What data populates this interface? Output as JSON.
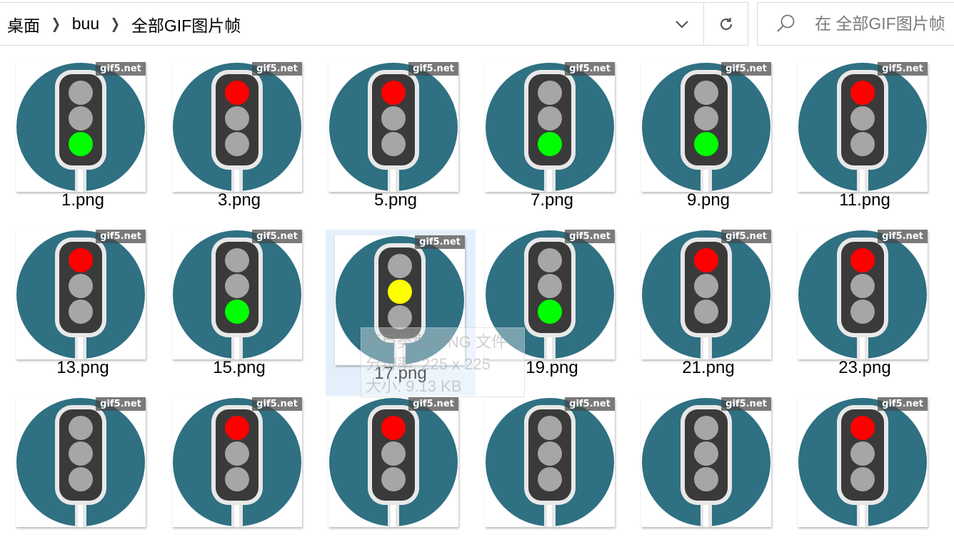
{
  "breadcrumb": [
    "桌面",
    "buu",
    "全部GIF图片帧"
  ],
  "search": {
    "placeholder": "在 全部GIF图片帧"
  },
  "watermark": "gif5.net",
  "colors": {
    "red": "#ff0000",
    "yellow": "#ffff00",
    "green": "#00ff00",
    "off": "#a6a6a6",
    "circle": "#2f7083",
    "housing": "#3a3a3a",
    "selection": "#e3f0fb"
  },
  "files": [
    {
      "name": "1.png",
      "light": "green"
    },
    {
      "name": "3.png",
      "light": "red"
    },
    {
      "name": "5.png",
      "light": "red"
    },
    {
      "name": "7.png",
      "light": "green"
    },
    {
      "name": "9.png",
      "light": "green"
    },
    {
      "name": "11.png",
      "light": "red"
    },
    {
      "name": "13.png",
      "light": "red"
    },
    {
      "name": "15.png",
      "light": "green"
    },
    {
      "name": "17.png",
      "light": "yellow",
      "selected": true
    },
    {
      "name": "19.png",
      "light": "green"
    },
    {
      "name": "21.png",
      "light": "red"
    },
    {
      "name": "23.png",
      "light": "red"
    },
    {
      "name": "",
      "light": "off"
    },
    {
      "name": "",
      "light": "red"
    },
    {
      "name": "",
      "light": "red"
    },
    {
      "name": "",
      "light": "off"
    },
    {
      "name": "",
      "light": "off"
    },
    {
      "name": "",
      "light": "red"
    }
  ],
  "tooltip": {
    "type": "项目类型: PNG 文件",
    "dimensions": "分辨率: 225 x 225",
    "size": "大小: 9.13 KB"
  }
}
